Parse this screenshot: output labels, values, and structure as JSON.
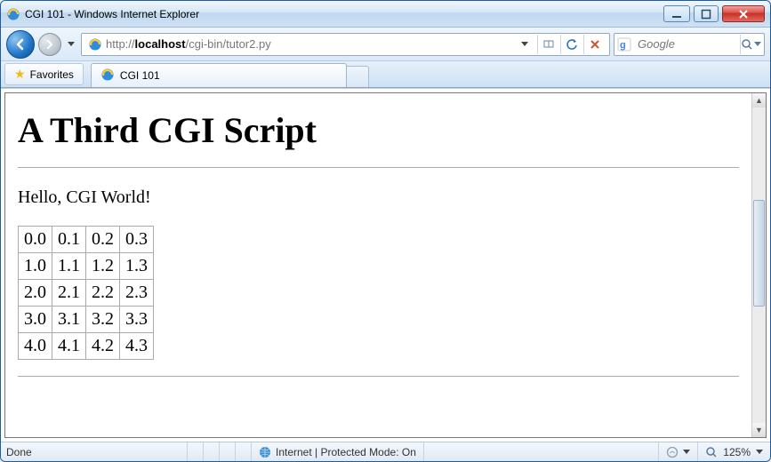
{
  "window": {
    "title": "CGI 101 - Windows Internet Explorer"
  },
  "address": {
    "prefix": "http://",
    "host": "localhost",
    "path": "/cgi-bin/tutor2.py"
  },
  "search": {
    "placeholder": "Google"
  },
  "favorites": {
    "label": "Favorites"
  },
  "tab": {
    "title": "CGI 101"
  },
  "page": {
    "heading": "A Third CGI Script",
    "hello": "Hello, CGI World!",
    "table": [
      [
        "0.0",
        "0.1",
        "0.2",
        "0.3"
      ],
      [
        "1.0",
        "1.1",
        "1.2",
        "1.3"
      ],
      [
        "2.0",
        "2.1",
        "2.2",
        "2.3"
      ],
      [
        "3.0",
        "3.1",
        "3.2",
        "3.3"
      ],
      [
        "4.0",
        "4.1",
        "4.2",
        "4.3"
      ]
    ]
  },
  "status": {
    "left": "Done",
    "zone": "Internet | Protected Mode: On",
    "zoom": "125%"
  },
  "icons": {
    "ie": "ie-logo-icon",
    "star": "favorite-star-icon",
    "refresh": "refresh-icon",
    "stop": "stop-icon",
    "dropdown": "dropdown-icon",
    "compat": "compat-view-icon",
    "google": "google-icon",
    "search": "search-icon",
    "globe": "globe-icon",
    "zoom": "magnifier-icon"
  }
}
